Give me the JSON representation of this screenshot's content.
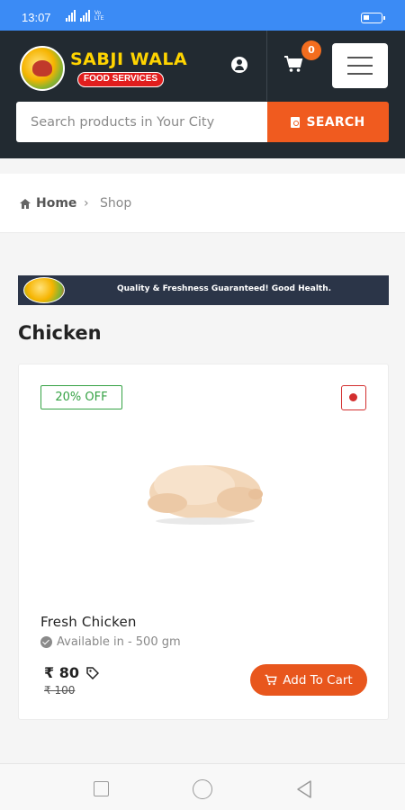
{
  "status_bar": {
    "time": "13:07",
    "network_label": "Vo LTE"
  },
  "header": {
    "logo_title": "SABJI WALA",
    "logo_subtitle": "FOOD SERVICES",
    "cart_count": "0",
    "search": {
      "placeholder": "Search products in Your City",
      "button_label": "SEARCH"
    }
  },
  "breadcrumb": {
    "home": "Home",
    "separator": "›",
    "current": "Shop"
  },
  "banner": {
    "text": "Quality & Freshness Guaranteed! Good Health."
  },
  "category": {
    "title": "Chicken"
  },
  "product": {
    "discount": "20% OFF",
    "name": "Fresh Chicken",
    "availability": "Available in - 500 gm",
    "price": "₹ 80",
    "mrp": "₹ 100",
    "add_to_cart": "Add To Cart"
  },
  "colors": {
    "status_bar": "#3b8bf5",
    "header_bg": "#222a31",
    "accent_orange": "#f05b1f",
    "discount_green": "#35a244",
    "nonveg_red": "#d32f2f"
  },
  "icons": [
    "user-icon",
    "cart-icon",
    "menu-icon",
    "search-doc-icon",
    "home-icon",
    "check-circle-icon",
    "tag-icon",
    "nonveg-mark-icon",
    "nav-recents-icon",
    "nav-home-icon",
    "nav-back-icon"
  ]
}
